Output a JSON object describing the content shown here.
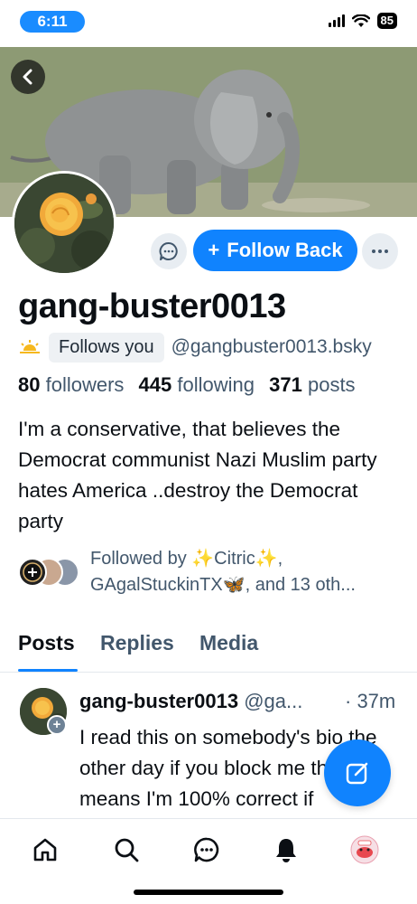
{
  "status_bar": {
    "time": "6:11",
    "battery": "85"
  },
  "profile": {
    "display_name": "gang-buster0013",
    "follows_you_label": "Follows you",
    "handle": "@gangbuster0013.bsky",
    "followers_count": "80",
    "followers_label": "followers",
    "following_count": "445",
    "following_label": "following",
    "posts_count": "371",
    "posts_label": "posts",
    "bio": "I'm a conservative, that believes the Democrat communist Nazi Muslim party hates America ..destroy the Democrat party",
    "followed_by_line1": "Followed by ✨Citric✨,",
    "followed_by_line2": "GAgalStuckinTX🦋, and 13 oth..."
  },
  "actions": {
    "follow_back_label": "Follow Back",
    "follow_plus": "+"
  },
  "tabs": [
    {
      "label": "Posts",
      "active": true
    },
    {
      "label": "Replies",
      "active": false
    },
    {
      "label": "Media",
      "active": false
    }
  ],
  "post": {
    "author": "gang-buster0013",
    "handle": "@ga...",
    "time": "· 37m",
    "text": "I read this on somebody's bio the other day if you block me that means I'm 100% correct if"
  },
  "nav": [
    "home-icon",
    "search-icon",
    "chat-icon",
    "notifications-icon",
    "profile-avatar"
  ],
  "colors": {
    "accent": "#1083fe",
    "muted": "#42576c",
    "time_pill": "#1a8cff"
  }
}
